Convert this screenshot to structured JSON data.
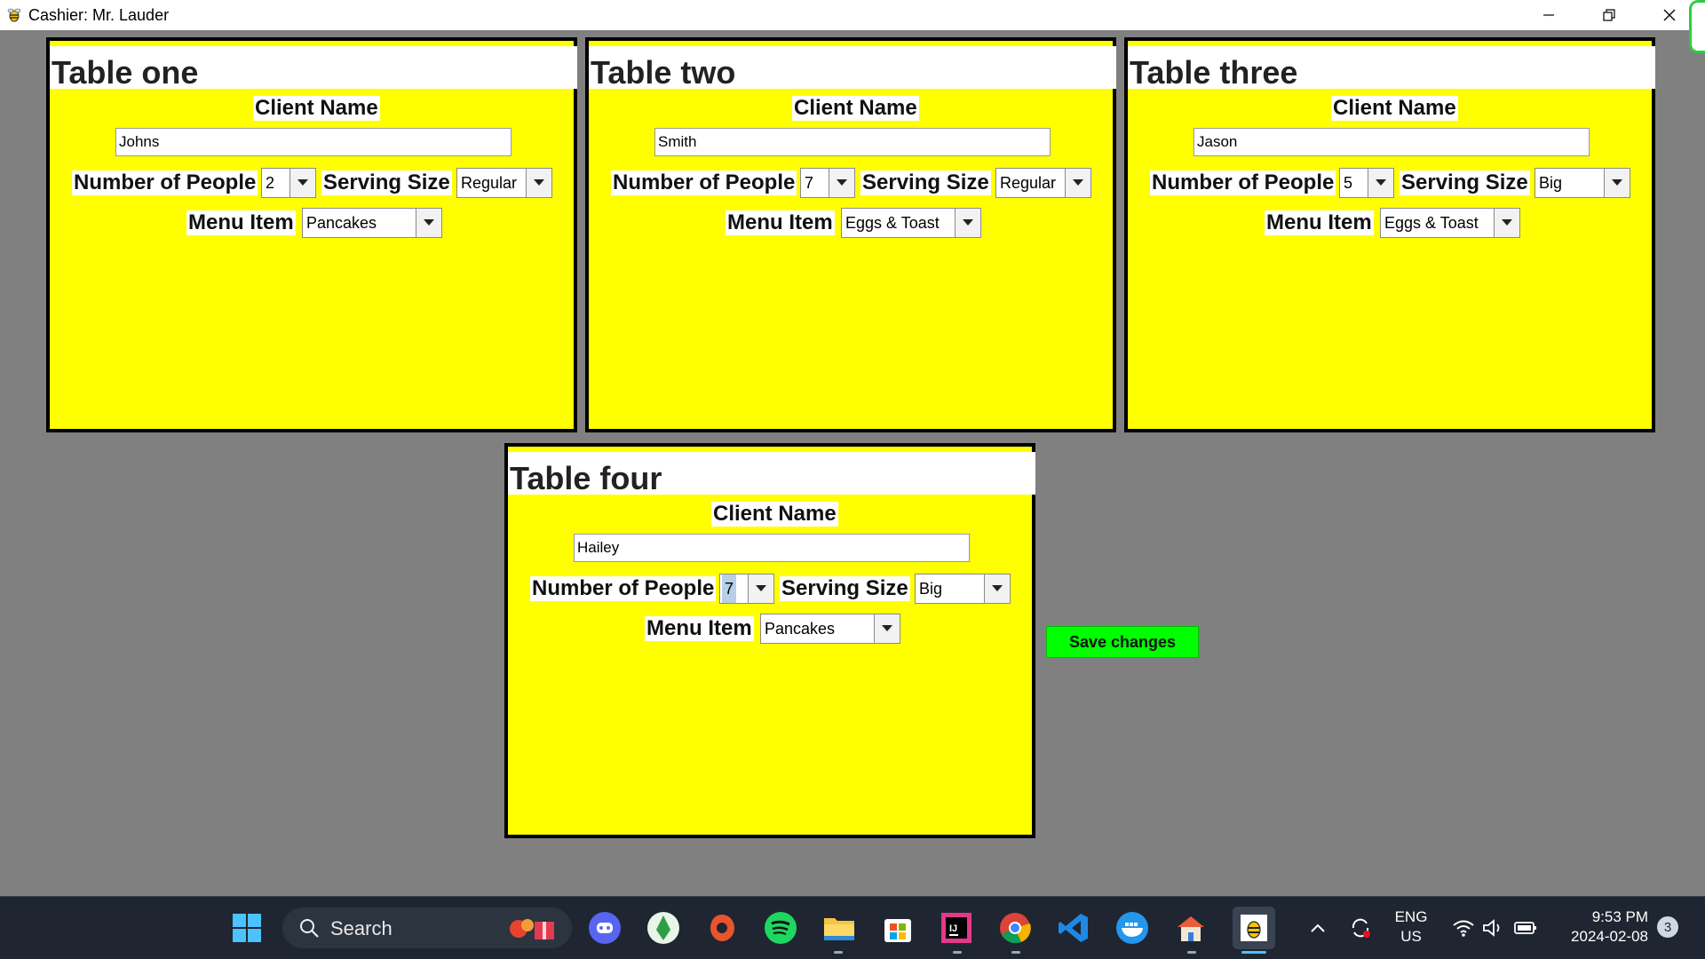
{
  "window": {
    "title": "Cashier: Mr. Lauder"
  },
  "labels": {
    "client_name": "Client Name",
    "number_of_people": "Number of People",
    "serving_size": "Serving Size",
    "menu_item": "Menu Item"
  },
  "tables": [
    {
      "title": "Table one",
      "client": "Johns",
      "people": "2",
      "size": "Regular",
      "menu": "Pancakes"
    },
    {
      "title": "Table two",
      "client": "Smith",
      "people": "7",
      "size": "Regular",
      "menu": "Eggs & Toast"
    },
    {
      "title": "Table three",
      "client": "Jason",
      "people": "5",
      "size": "Big",
      "menu": "Eggs & Toast"
    },
    {
      "title": "Table four",
      "client": "Hailey",
      "people": "7",
      "size": "Big",
      "menu": "Pancakes"
    }
  ],
  "save_button": "Save changes",
  "taskbar": {
    "search_label": "Search",
    "language": "ENG",
    "region": "US",
    "time": "9:53 PM",
    "date": "2024-02-08",
    "notification_count": "3"
  },
  "colors": {
    "panel_bg": "#ffff00",
    "save_bg": "#00ff00",
    "desktop_bg": "#808080",
    "taskbar_bg": "#1f2631"
  }
}
